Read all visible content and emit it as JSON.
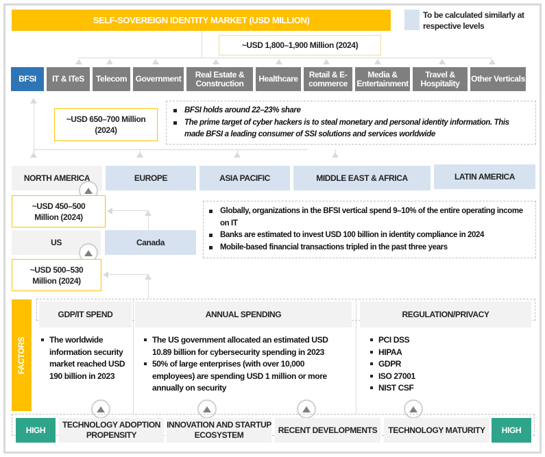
{
  "title": "SELF-SOVEREIGN IDENTITY MARKET (USD MILLION)",
  "legend": {
    "text": "To be calculated similarly at respective levels",
    "swatch_color": "#d6e2ef"
  },
  "total_market": "~USD 1,800–1,900 Million (2024)",
  "verticals": [
    {
      "label": "BFSI",
      "highlighted": true
    },
    {
      "label": "IT & ITeS"
    },
    {
      "label": "Telecom"
    },
    {
      "label": "Government"
    },
    {
      "label": "Real Estate & Construction"
    },
    {
      "label": "Healthcare"
    },
    {
      "label": "Retail & E-commerce"
    },
    {
      "label": "Media & Entertainment"
    },
    {
      "label": "Travel & Hospitality"
    },
    {
      "label": "Other Verticals"
    }
  ],
  "bfsi_value": {
    "line1": "~USD 650–700 Million",
    "line2": "(2024)"
  },
  "bfsi_notes": [
    "BFSI holds around 22–23% share",
    "The prime target of cyber hackers is to steal monetary and personal identity information. This made BFSI a leading consumer of SSI solutions and services worldwide"
  ],
  "regions": [
    {
      "label": "NORTH AMERICA",
      "style": "gray"
    },
    {
      "label": "EUROPE",
      "style": "blue"
    },
    {
      "label": "ASIA PACIFIC",
      "style": "blue"
    },
    {
      "label": "MIDDLE EAST & AFRICA",
      "style": "blue"
    },
    {
      "label": "LATIN AMERICA",
      "style": "blue"
    }
  ],
  "north_america_value": {
    "line1": "~USD 450–500",
    "line2": "Million (2024)"
  },
  "countries": [
    {
      "label": "US",
      "style": "gray"
    },
    {
      "label": "Canada",
      "style": "blue"
    }
  ],
  "us_value": {
    "line1": "~USD 500–530",
    "line2": "Million (2024)"
  },
  "na_notes": [
    "Globally, organizations in the BFSI vertical spend 9–10% of the entire operating income on IT",
    "Banks are estimated to invest USD 100 billion in identity compliance in 2024",
    "Mobile-based financial transactions tripled in the past three years"
  ],
  "factors": {
    "label": "FACTORS",
    "columns": [
      {
        "heading": "GDP/IT SPEND",
        "bullets": [
          "The worldwide information security market reached USD 190 billion in 2023"
        ]
      },
      {
        "heading": "ANNUAL SPENDING",
        "bullets": [
          "The US government allocated an estimated USD 10.89 billion for cybersecurity spending in 2023",
          "50% of large enterprises (with over 10,000 employees) are spending USD 1 million or more annually on security"
        ]
      },
      {
        "heading": "REGULATION/PRIVACY",
        "bullets": [
          "PCI DSS",
          "HIPAA",
          "GDPR",
          "ISO 27001",
          "NIST CSF"
        ]
      }
    ]
  },
  "bottom_row": {
    "left_badge": "HIGH",
    "right_badge": "HIGH",
    "badge_color": "#2ea58a",
    "items": [
      "TECHNOLOGY ADOPTION PROPENSITY",
      "INNOVATION AND STARTUP ECOSYSTEM",
      "RECENT DEVELOPMENTS",
      "TECHNOLOGY MATURITY"
    ]
  },
  "colors": {
    "accent_yellow": "#ffc000",
    "bfsi_blue": "#2e75b6",
    "vertical_gray": "#7f7f7f"
  }
}
